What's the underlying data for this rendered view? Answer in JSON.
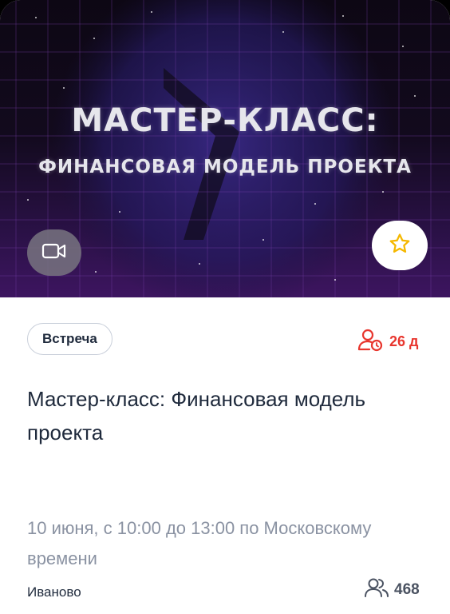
{
  "banner": {
    "title_line1": "МАСТЕР-КЛАСС:",
    "title_line2": "ФИНАНСОВАЯ МОДЕЛЬ ПРОЕКТА"
  },
  "icons": {
    "video": "video-camera-icon",
    "favorite": "star-icon",
    "deadline": "user-clock-icon",
    "participants": "users-icon"
  },
  "event": {
    "type": "Встреча",
    "deadline": "26 д",
    "title": "Мастер-класс: Финансовая модель проекта",
    "datetime": "10 июня, с 10:00 до 13:00 по Московскому времени",
    "city": "Иваново",
    "participants": "468"
  },
  "colors": {
    "accent_red": "#e8362e",
    "star_yellow": "#f5b800",
    "text_dark": "#1f2a3c",
    "text_muted": "#8a92a2"
  }
}
